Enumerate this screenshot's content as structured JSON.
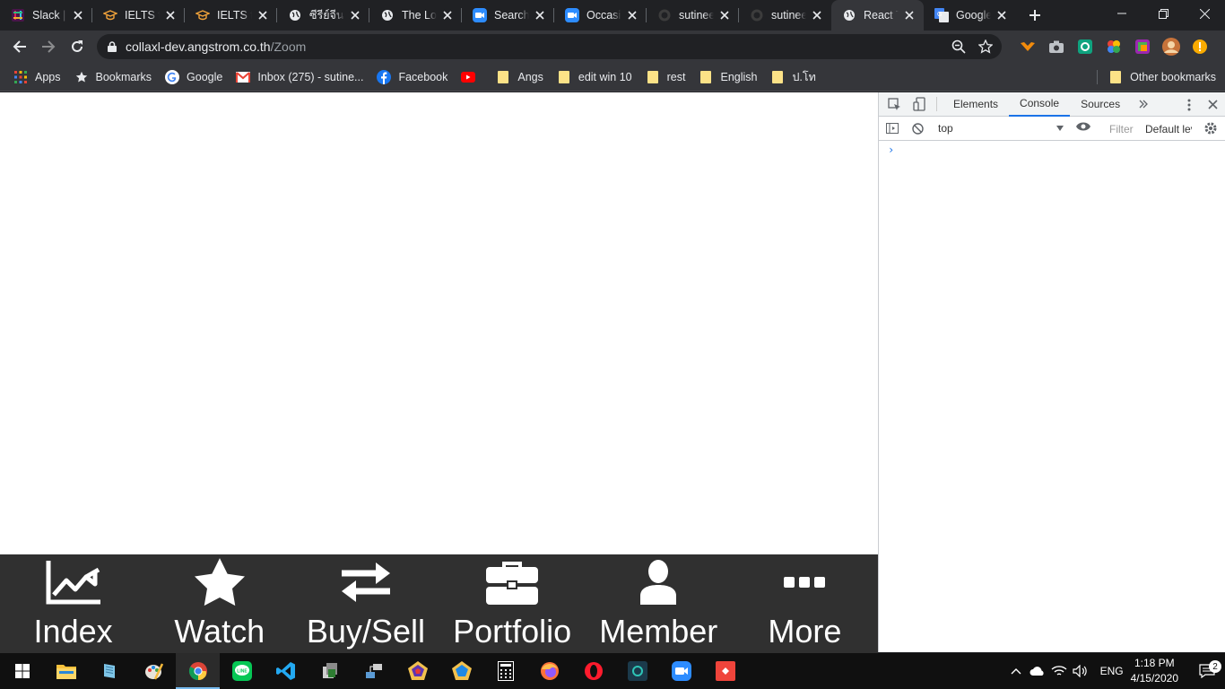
{
  "tabs": [
    {
      "title": "Slack | r",
      "icon": "slack-icon"
    },
    {
      "title": "IELTS fo",
      "icon": "graduation-cap-icon"
    },
    {
      "title": "IELTS fo",
      "icon": "graduation-cap-icon"
    },
    {
      "title": "ซีรีย์จีน",
      "icon": "globe-icon"
    },
    {
      "title": "The Lov",
      "icon": "globe-icon"
    },
    {
      "title": "Search",
      "icon": "zoom-icon"
    },
    {
      "title": "Occasio",
      "icon": "zoom-icon"
    },
    {
      "title": "sutinee",
      "icon": "github-icon"
    },
    {
      "title": "sutinee",
      "icon": "github-icon"
    },
    {
      "title": "React T",
      "icon": "globe-icon",
      "active": true
    },
    {
      "title": "Google",
      "icon": "google-translate-icon"
    }
  ],
  "address": {
    "host": "collaxl-dev.angstrom.co.th",
    "path": "/Zoom"
  },
  "bookmarks": {
    "items": [
      {
        "label": "Apps",
        "icon": "apps-grid-icon"
      },
      {
        "label": "Bookmarks",
        "icon": "star-icon"
      },
      {
        "label": "Google",
        "icon": "google-icon"
      },
      {
        "label": "Inbox (275) - sutine...",
        "icon": "gmail-icon"
      },
      {
        "label": "Facebook",
        "icon": "facebook-icon"
      },
      {
        "label": "",
        "icon": "youtube-icon"
      },
      {
        "label": "Angs",
        "icon": "folder-icon"
      },
      {
        "label": "edit win 10",
        "icon": "folder-icon"
      },
      {
        "label": "rest",
        "icon": "folder-icon"
      },
      {
        "label": "English",
        "icon": "folder-icon"
      },
      {
        "label": "ป.โท",
        "icon": "folder-icon"
      }
    ],
    "other": "Other bookmarks"
  },
  "bottom_nav": [
    {
      "label": "Index",
      "icon": "chart-line-icon"
    },
    {
      "label": "Watch",
      "icon": "star-icon"
    },
    {
      "label": "Buy/Sell",
      "icon": "exchange-arrows-icon"
    },
    {
      "label": "Portfolio",
      "icon": "briefcase-icon"
    },
    {
      "label": "Member",
      "icon": "user-icon"
    },
    {
      "label": "More",
      "icon": "ellipsis-icon"
    }
  ],
  "devtools": {
    "tabs": [
      "Elements",
      "Console",
      "Sources"
    ],
    "active_tab": "Console",
    "context": "top",
    "filter_placeholder": "Filter",
    "levels": "Default levels",
    "prompt": "›"
  },
  "taskbar": {
    "apps": [
      "file-explorer-icon",
      "notepad-icon",
      "paint-icon",
      "chrome-icon",
      "line-icon",
      "vscode-icon",
      "teams-icon",
      "network-icon",
      "app-pentagon-icon",
      "app-pentagon2-icon",
      "calculator-icon",
      "firefox-icon",
      "opera-icon",
      "vpn-icon",
      "zoom-icon",
      "anydesk-icon"
    ],
    "active_app": "chrome-icon",
    "language": "ENG",
    "time": "1:18 PM",
    "date": "4/15/2020",
    "notifications": "2"
  },
  "colors": {
    "chrome_dark": "#202124",
    "chrome_toolbar": "#35363a",
    "nav_bar": "#303030",
    "accent_blue": "#1a73e8"
  }
}
